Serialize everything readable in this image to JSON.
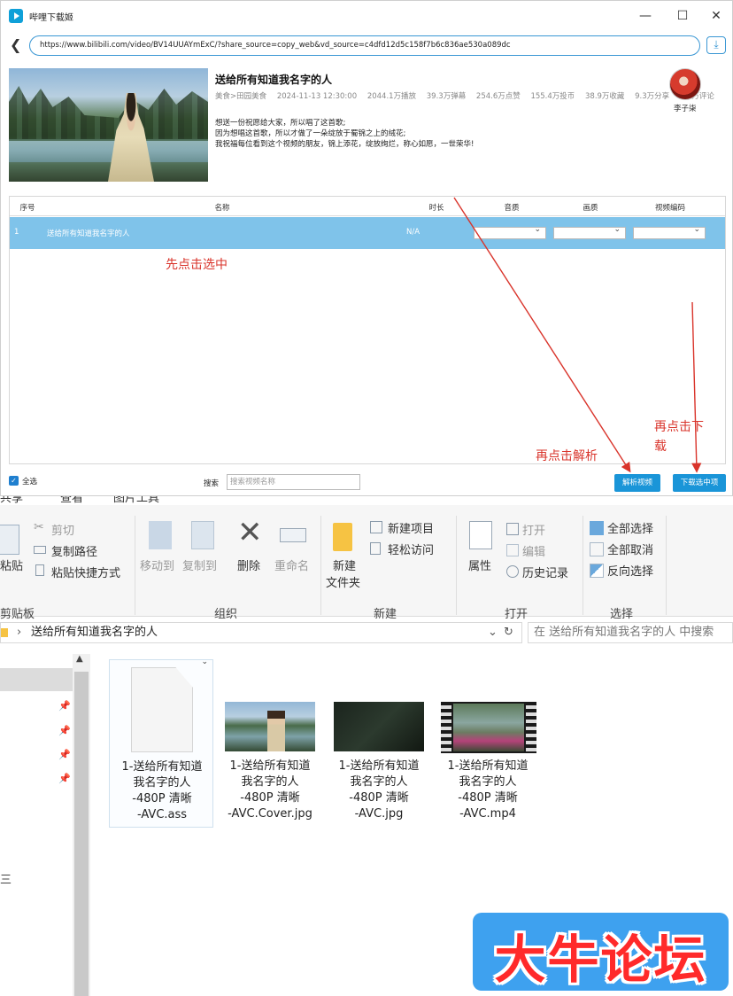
{
  "app": {
    "title": "哔哩下载姬",
    "url": "https://www.bilibili.com/video/BV14UUAYmExC/?share_source=copy_web&vd_source=c4dfd12d5c158f7b6c836ae530a089dc",
    "video": {
      "title": "送给所有知道我名字的人",
      "category": "美食>田园美食",
      "date": "2024-11-13 12:30:00",
      "plays": "2044.1万播放",
      "danmaku": "39.3万弹幕",
      "likes": "254.6万点赞",
      "coins": "155.4万投币",
      "favorites": "38.9万收藏",
      "shares": "9.3万分享",
      "comments": "4.7万评论",
      "desc_lines": [
        "想送一份祝愿给大家，所以唱了这首歌;",
        "因为想唱这首歌，所以才做了一朵绽放于蜀锦之上的绒花;",
        "我祝福每位看到这个视频的朋友，锦上添花，绽放绚烂，称心如愿，一世荣华!"
      ],
      "author": "李子柒"
    },
    "table": {
      "headers": [
        "序号",
        "名称",
        "时长",
        "音质",
        "画质",
        "视频编码"
      ],
      "rows": [
        {
          "index": "1",
          "name": "送给所有知道我名字的人",
          "duration": "N/A"
        }
      ]
    },
    "annotations": {
      "select_first": "先点击选中",
      "then_parse": "再点击解析",
      "then_download_1": "再点击下",
      "then_download_2": "载"
    },
    "select_all": "全选",
    "search_label": "搜索",
    "search_placeholder": "搜索视频名称",
    "parse_button": "解析视频",
    "download_button": "下载选中项"
  },
  "explorer": {
    "tabs": [
      "共享",
      "查看",
      "图片工具"
    ],
    "clipboard": {
      "paste": "粘贴",
      "cut": "剪切",
      "copy_path": "复制路径",
      "paste_shortcut": "粘贴快捷方式",
      "label": "剪贴板"
    },
    "organize": {
      "move_to": "移动到",
      "copy_to": "复制到",
      "delete": "删除",
      "rename": "重命名",
      "label": "组织"
    },
    "new": {
      "new_item": "新建项目",
      "easy_access": "轻松访问",
      "new_folder_1": "新建",
      "new_folder_2": "文件夹",
      "label": "新建"
    },
    "open": {
      "properties": "属性",
      "open": "打开",
      "edit": "编辑",
      "history": "历史记录",
      "label": "打开"
    },
    "select": {
      "select_all": "全部选择",
      "select_none": "全部取消",
      "invert": "反向选择",
      "label": "选择"
    },
    "path": "送给所有知道我名字的人",
    "search_placeholder": "在 送给所有知道我名字的人 中搜索",
    "files": [
      {
        "lines": [
          "1-送给所有知道",
          "我名字的人",
          "-480P 清晰",
          "-AVC.ass"
        ]
      },
      {
        "lines": [
          "1-送给所有知道",
          "我名字的人",
          "-480P 清晰",
          "-AVC.Cover.jpg"
        ]
      },
      {
        "lines": [
          "1-送给所有知道",
          "我名字的人",
          "-480P 清晰",
          "-AVC.jpg"
        ]
      },
      {
        "lines": [
          "1-送给所有知道",
          "我名字的人",
          "-480P 清晰",
          "-AVC.mp4"
        ]
      }
    ]
  },
  "watermark": "大牛论坛",
  "colors": {
    "accent": "#1a95d8",
    "selected_row": "#7fc3ea",
    "annotation": "#d9342b"
  }
}
